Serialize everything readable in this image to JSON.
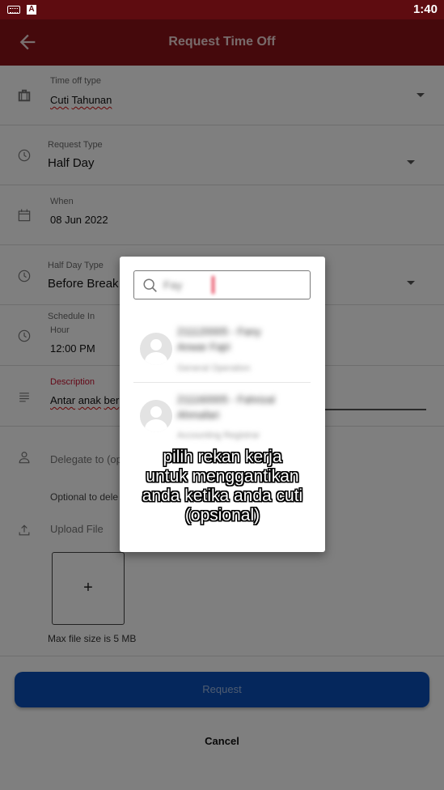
{
  "status_bar": {
    "time": "1:40",
    "icons": [
      "keyboard-icon",
      "a-badge-icon"
    ]
  },
  "app_bar": {
    "title": "Request Time Off",
    "back_icon": "arrow-left-icon"
  },
  "form": {
    "time_off_type": {
      "label": "Time off type",
      "value_word1": "Cuti",
      "value_word2": "Tahunan",
      "icon": "briefcase-icon"
    },
    "request_type": {
      "label": "Request Type",
      "value": "Half Day",
      "icon": "clock-icon"
    },
    "when": {
      "label": "When",
      "value": "08 Jun 2022",
      "icon": "calendar-icon"
    },
    "half_day_type": {
      "label": "Half Day Type",
      "value": "Before Break",
      "icon": "clock-icon"
    },
    "schedule_in": {
      "label": "Schedule In",
      "sublabel": "Hour",
      "value": "12:00 PM",
      "icon": "clock-icon"
    },
    "description": {
      "label": "Description",
      "value_word1": "Antar",
      "value_word2": "anak",
      "value_word3": "ber",
      "icon": "notes-icon"
    },
    "delegate": {
      "placeholder": "Delegate to (op",
      "helper": "Optional to dele",
      "icon": "person-icon"
    },
    "upload": {
      "label": "Upload File",
      "plus": "+",
      "max_size": "Max file size is 5 MB",
      "icon": "upload-icon"
    }
  },
  "buttons": {
    "request": "Request",
    "cancel": "Cancel"
  },
  "dialog": {
    "search_value": "Fay",
    "people": [
      {
        "name": "211120005 - Fany Anwar Fajri",
        "role": "General Operation"
      },
      {
        "name": "211160005 - Fahrizal Ahmafari",
        "role": "Accounting Registrar"
      }
    ]
  },
  "caption": {
    "line1": "pilih rekan kerja",
    "line2": "untuk menggantikan",
    "line3": "anda ketika anda cuti",
    "line4": "(opsional)"
  },
  "colors": {
    "app_bar": "#8a1318",
    "status_bar": "#5e0c10",
    "primary_button": "#0b4fb8",
    "description_label": "#c8102e"
  }
}
